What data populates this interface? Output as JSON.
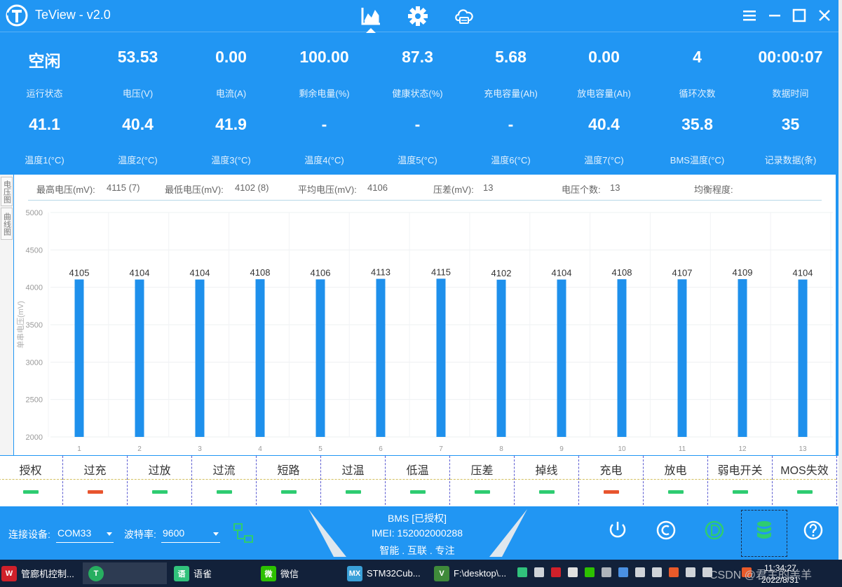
{
  "app": {
    "title": "TeView - v2.0"
  },
  "stats": {
    "row1": [
      {
        "value": "空闲",
        "label": "运行状态"
      },
      {
        "value": "53.53",
        "label": "电压(V)"
      },
      {
        "value": "0.00",
        "label": "电流(A)"
      },
      {
        "value": "100.00",
        "label": "剩余电量(%)"
      },
      {
        "value": "87.3",
        "label": "健康状态(%)"
      },
      {
        "value": "5.68",
        "label": "充电容量(Ah)"
      },
      {
        "value": "0.00",
        "label": "放电容量(Ah)"
      },
      {
        "value": "4",
        "label": "循环次数"
      },
      {
        "value": "00:00:07",
        "label": "数据时间"
      }
    ],
    "row2": [
      {
        "value": "41.1",
        "label": "温度1(°C)"
      },
      {
        "value": "40.4",
        "label": "温度2(°C)"
      },
      {
        "value": "41.9",
        "label": "温度3(°C)"
      },
      {
        "value": "-",
        "label": "温度4(°C)"
      },
      {
        "value": "-",
        "label": "温度5(°C)"
      },
      {
        "value": "-",
        "label": "温度6(°C)"
      },
      {
        "value": "40.4",
        "label": "温度7(°C)"
      },
      {
        "value": "35.8",
        "label": "BMS温度(°C)"
      },
      {
        "value": "35",
        "label": "记录数据(条)"
      }
    ]
  },
  "side_tabs": {
    "voltage_chart": "电压图",
    "curve_chart": "曲线图"
  },
  "summary": {
    "max_label": "最高电压(mV):",
    "max_value": "4115 (7)",
    "min_label": "最低电压(mV):",
    "min_value": "4102 (8)",
    "avg_label": "平均电压(mV):",
    "avg_value": "4106",
    "diff_label": "压差(mV):",
    "diff_value": "13",
    "count_label": "电压个数:",
    "count_value": "13",
    "balance_label": "均衡程度:"
  },
  "chart_data": {
    "type": "bar",
    "ylabel": "单串电压(mV)",
    "ylim": [
      2000,
      5000
    ],
    "yticks": [
      "5000",
      "4500",
      "4000",
      "3500",
      "3000",
      "2500",
      "2000"
    ],
    "categories": [
      "1",
      "2",
      "3",
      "4",
      "5",
      "6",
      "7",
      "8",
      "9",
      "10",
      "11",
      "12",
      "13"
    ],
    "values": [
      4105,
      4104,
      4104,
      4108,
      4106,
      4113,
      4115,
      4102,
      4104,
      4108,
      4107,
      4109,
      4104
    ],
    "color": "#1E90EC",
    "grid": true
  },
  "alarms": [
    {
      "label": "授权",
      "state": "ok"
    },
    {
      "label": "过充",
      "state": "alert"
    },
    {
      "label": "过放",
      "state": "ok"
    },
    {
      "label": "过流",
      "state": "ok"
    },
    {
      "label": "短路",
      "state": "ok"
    },
    {
      "label": "过温",
      "state": "ok"
    },
    {
      "label": "低温",
      "state": "ok"
    },
    {
      "label": "压差",
      "state": "ok"
    },
    {
      "label": "掉线",
      "state": "ok"
    },
    {
      "label": "充电",
      "state": "alert"
    },
    {
      "label": "放电",
      "state": "ok"
    },
    {
      "label": "弱电开关",
      "state": "ok"
    },
    {
      "label": "MOS失效",
      "state": "ok"
    }
  ],
  "colors": {
    "ok": "#2ECC71",
    "alert": "#E8542E",
    "accent": "#2196F3"
  },
  "bottom": {
    "device_label": "连接设备:",
    "device_value": "COM33",
    "baud_label": "波特率:",
    "baud_value": "9600",
    "bms_status": "BMS [已授权]",
    "imei": "IMEI: 152002000288",
    "slogan": "智能 . 互联 . 专注"
  },
  "icons": {
    "nav": [
      "chart-icon",
      "settings-gear-icon",
      "cloud-icon"
    ],
    "window": [
      "menu-icon",
      "minimize-icon",
      "maximize-icon",
      "close-icon"
    ],
    "tools": [
      "power-icon",
      "c-circle-icon",
      "d-circle-icon",
      "database-icon",
      "help-icon"
    ]
  },
  "taskbar": {
    "items": [
      "管廊机控制...",
      "语雀",
      "微信",
      "STM32Cub...",
      "F:\\desktop\\..."
    ],
    "time": "11:34:27",
    "date": "2022/8/31",
    "watermark": "CSDN @君主的羔羊"
  }
}
